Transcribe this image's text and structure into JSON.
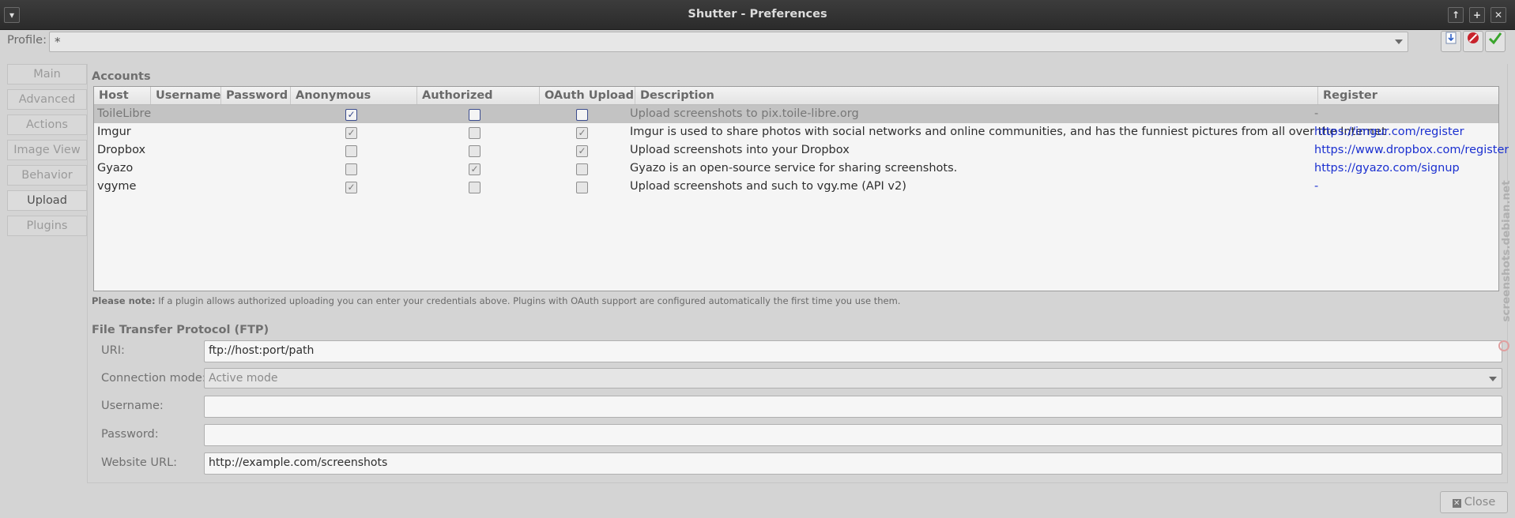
{
  "window": {
    "title": "Shutter - Preferences",
    "menu_icon": "chevron-down-icon",
    "buttons": [
      "↑",
      "+",
      "✕"
    ]
  },
  "profile": {
    "label": "Profile:",
    "value": "*"
  },
  "side_tabs": [
    {
      "label": "Main",
      "active": false
    },
    {
      "label": "Advanced",
      "active": false
    },
    {
      "label": "Actions",
      "active": false
    },
    {
      "label": "Image View",
      "active": false
    },
    {
      "label": "Behavior",
      "active": false
    },
    {
      "label": "Upload",
      "active": true
    },
    {
      "label": "Plugins",
      "active": false
    }
  ],
  "accounts": {
    "heading": "Accounts",
    "columns": [
      "Host",
      "Username",
      "Password",
      "Anonymous Upload",
      "Authorized Upload",
      "OAuth Upload",
      "Description",
      "Register"
    ],
    "rows": [
      {
        "host": "ToileLibre",
        "username": "",
        "password": "",
        "anonymous": true,
        "authorized": false,
        "oauth": false,
        "description": "Upload screenshots to pix.toile-libre.org",
        "register": "-",
        "selected": true
      },
      {
        "host": "Imgur",
        "username": "",
        "password": "",
        "anonymous": true,
        "authorized": false,
        "oauth": true,
        "description": "Imgur is used to share photos with social networks and online communities, and has the funniest pictures from all over the Internet",
        "register": "https://imgur.com/register",
        "selected": false
      },
      {
        "host": "Dropbox",
        "username": "",
        "password": "",
        "anonymous": false,
        "authorized": false,
        "oauth": true,
        "description": "Upload screenshots into your Dropbox",
        "register": "https://www.dropbox.com/register",
        "selected": false
      },
      {
        "host": "Gyazo",
        "username": "",
        "password": "",
        "anonymous": false,
        "authorized": true,
        "oauth": false,
        "description": "Gyazo is an open-source service for sharing screenshots.",
        "register": "https://gyazo.com/signup",
        "selected": false
      },
      {
        "host": "vgyme",
        "username": "",
        "password": "",
        "anonymous": true,
        "authorized": false,
        "oauth": false,
        "description": "Upload screenshots and such to vgy.me (API v2)",
        "register": "-",
        "selected": false
      }
    ]
  },
  "note": {
    "bold": "Please note:",
    "text": " If a plugin allows authorized uploading you can enter your credentials above. Plugins with OAuth support are configured automatically the first time you use them."
  },
  "ftp": {
    "heading": "File Transfer Protocol (FTP)",
    "uri_label": "URI:",
    "uri_value": "ftp://host:port/path",
    "mode_label": "Connection mode:",
    "mode_value": "Active mode",
    "username_label": "Username:",
    "username_value": "",
    "password_label": "Password:",
    "password_value": "",
    "website_label": "Website URL:",
    "website_value": "http://example.com/screenshots"
  },
  "close_label": "Close",
  "watermark": "screenshots.debian.net"
}
